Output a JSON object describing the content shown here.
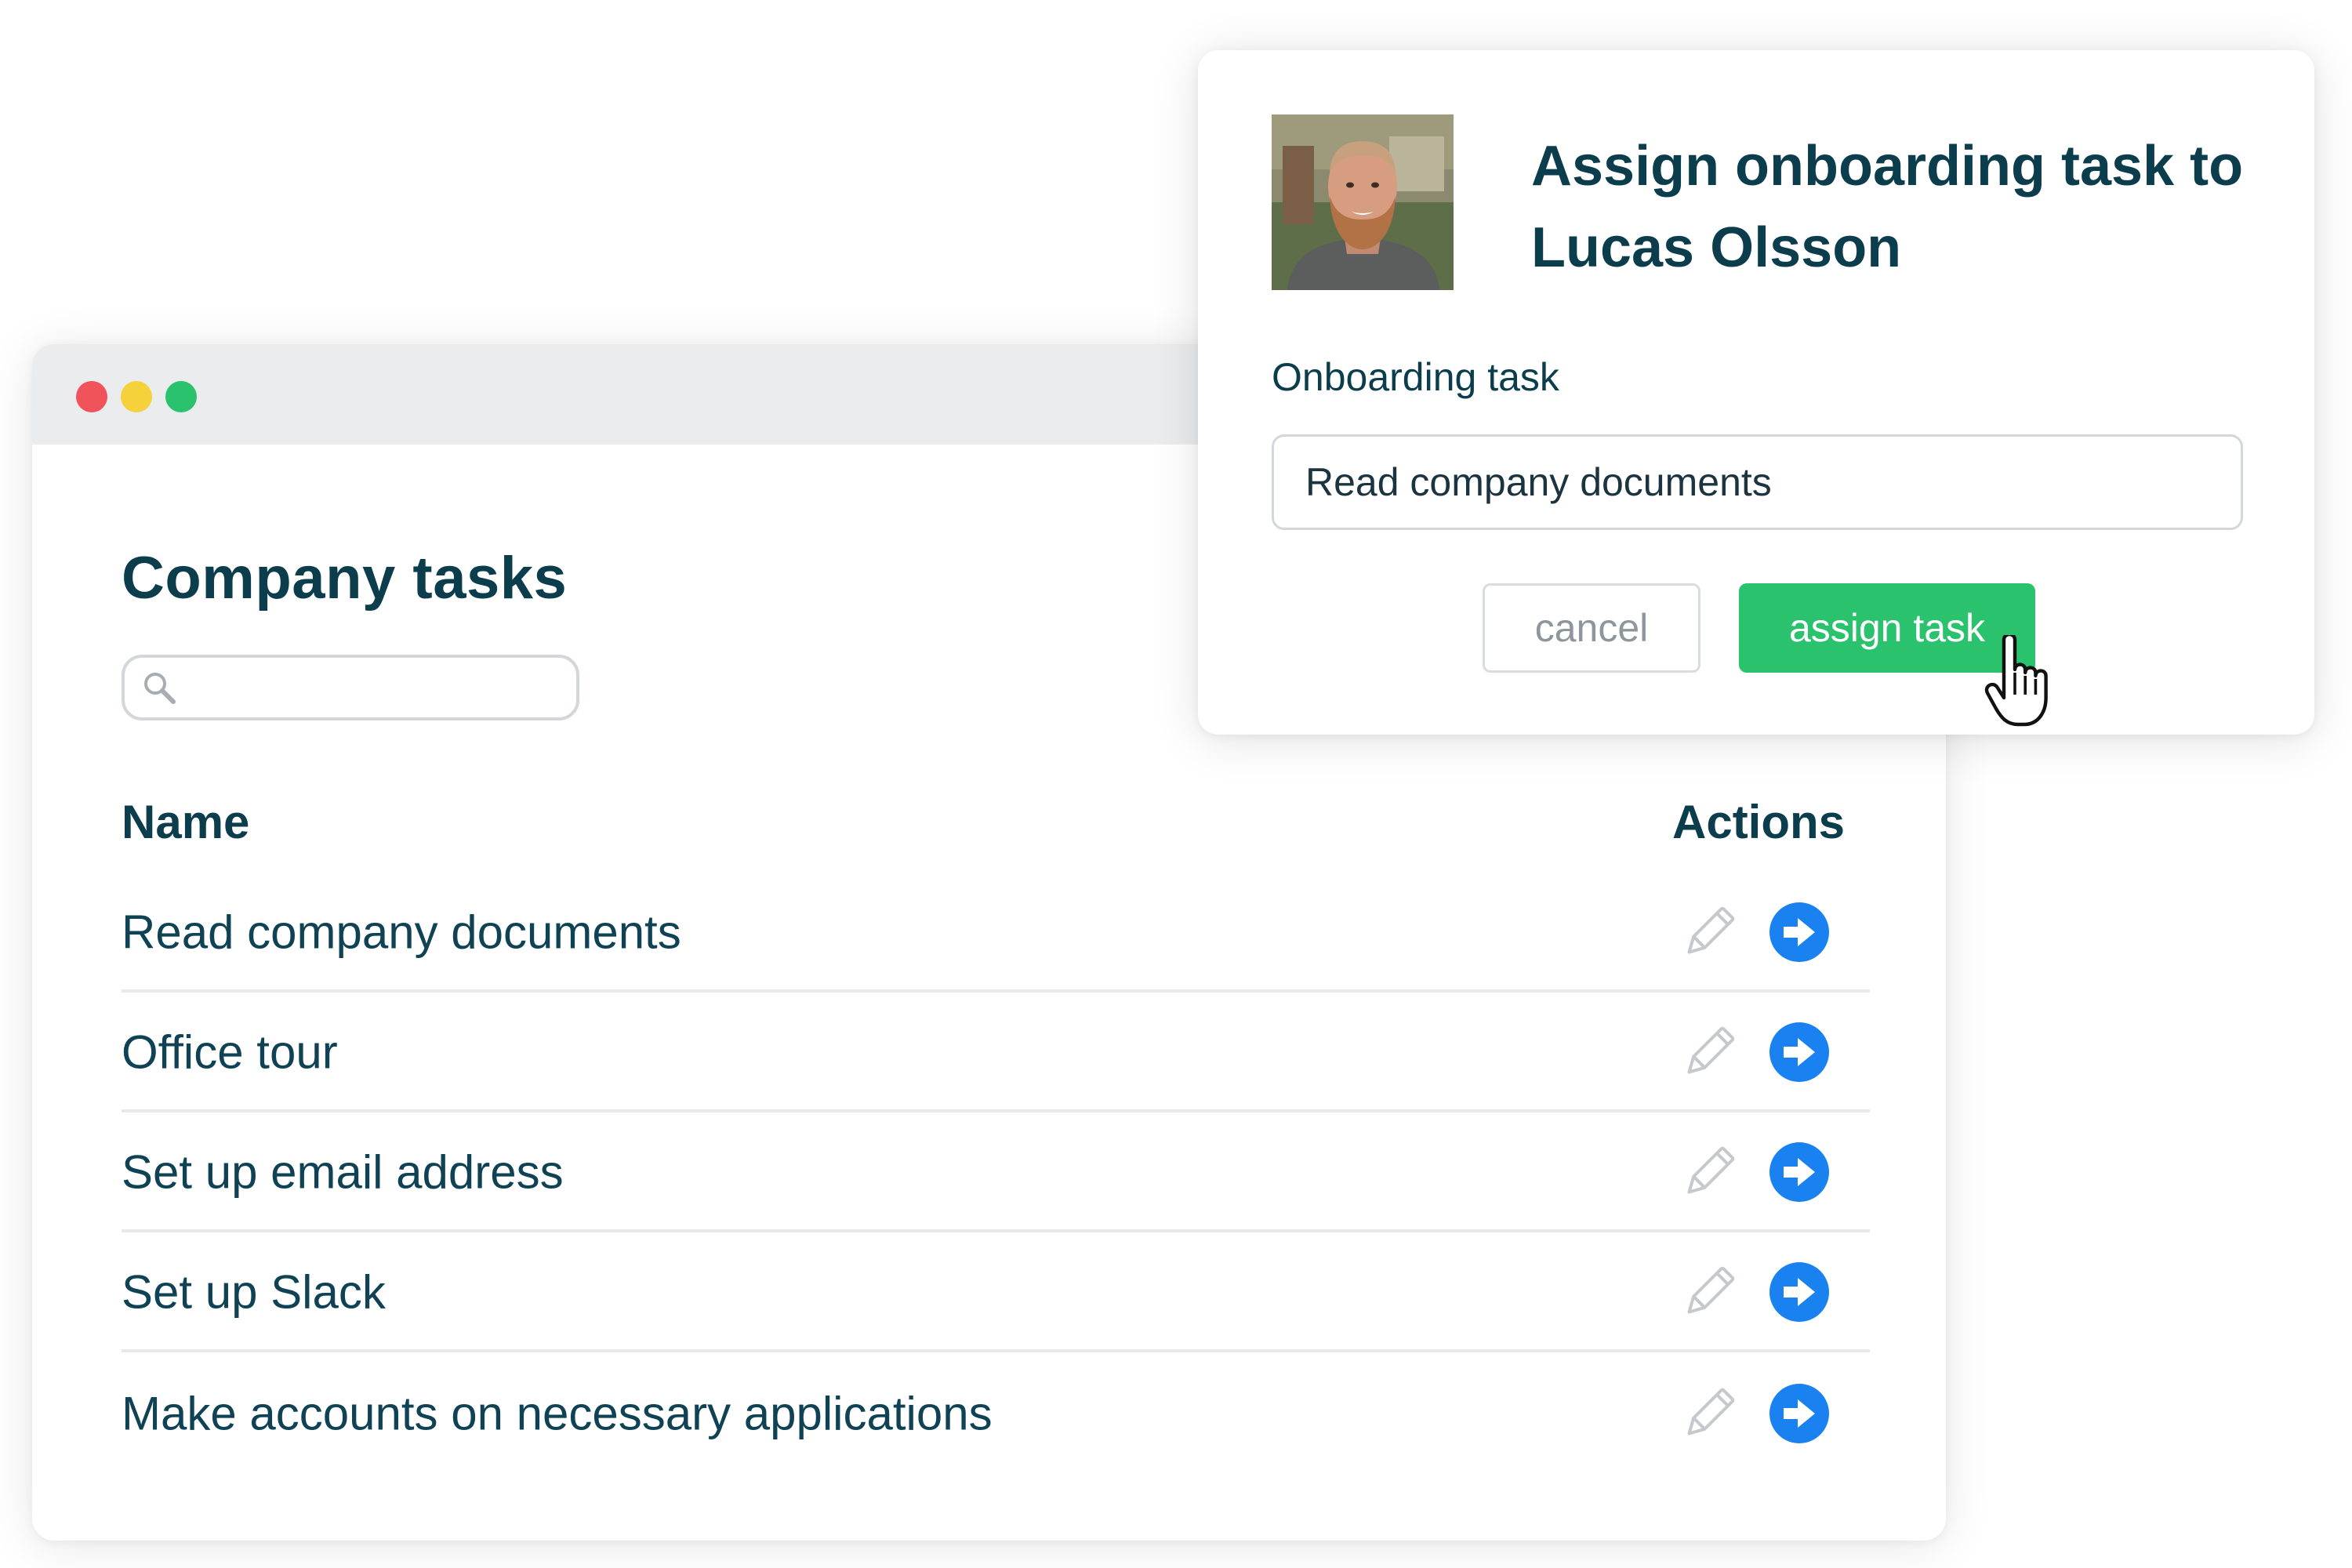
{
  "window": {
    "controls": [
      "close",
      "minimize",
      "maximize"
    ]
  },
  "tasks_page": {
    "title": "Company tasks",
    "search": {
      "value": "",
      "placeholder": ""
    },
    "columns": {
      "name": "Name",
      "actions": "Actions"
    },
    "rows": [
      {
        "name": "Read company documents",
        "actions": [
          "edit-icon",
          "assign-arrow-icon"
        ]
      },
      {
        "name": "Office tour",
        "actions": [
          "edit-icon",
          "assign-arrow-icon"
        ]
      },
      {
        "name": "Set up email address",
        "actions": [
          "edit-icon",
          "assign-arrow-icon"
        ]
      },
      {
        "name": "Set up Slack",
        "actions": [
          "edit-icon",
          "assign-arrow-icon"
        ]
      },
      {
        "name": "Make accounts on necessary applications",
        "actions": [
          "edit-icon",
          "assign-arrow-icon"
        ]
      }
    ]
  },
  "modal": {
    "title": "Assign onboarding task to Lucas Olsson",
    "field_label": "Onboarding task",
    "field_value": "Read company documents",
    "cancel_label": "cancel",
    "assign_label": "assign task"
  },
  "colors": {
    "heading": "#0c3d4d",
    "accent_green": "#2ac26d",
    "action_blue": "#1a82f0",
    "close_red": "#f1535a",
    "minimize_yellow": "#f5d13b",
    "maximize_green": "#2ac26d"
  }
}
